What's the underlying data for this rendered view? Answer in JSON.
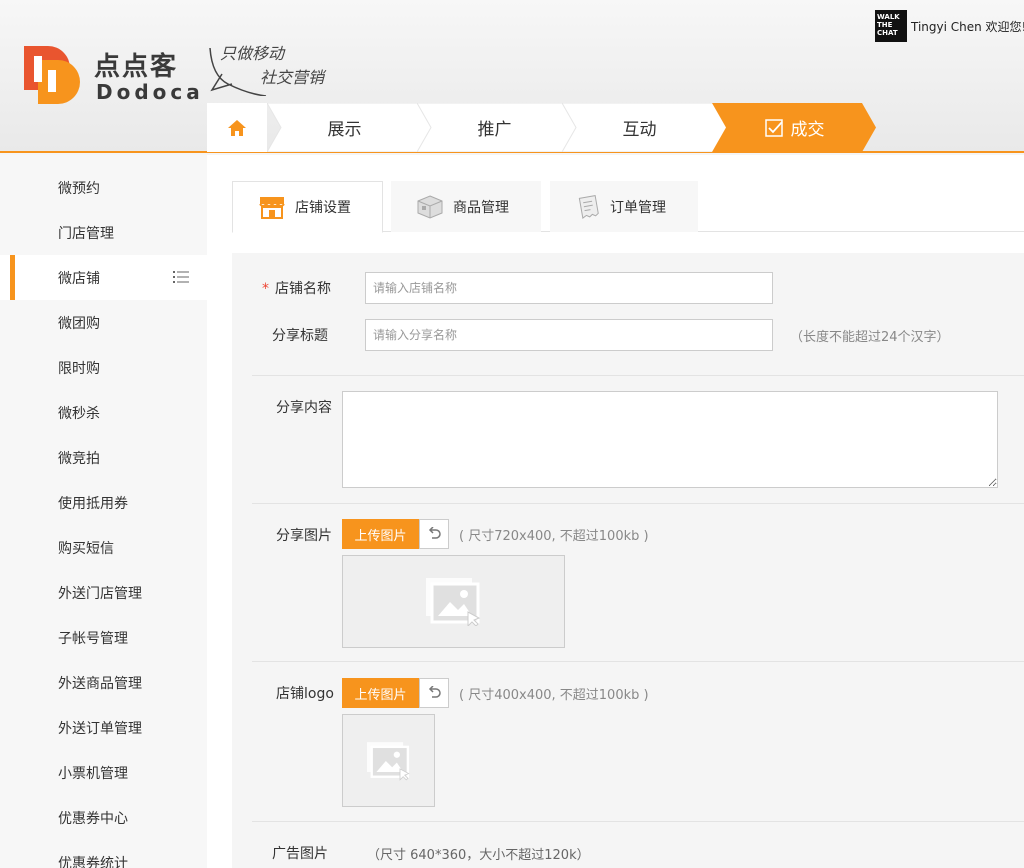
{
  "brand": {
    "name_cn": "点点客",
    "name_en": "Dodoca",
    "slogan_line1": "只做移动",
    "slogan_line2": "社交营销"
  },
  "user": {
    "badge_lines": [
      "WALK",
      "THE",
      "CHAT"
    ],
    "greeting": "Tingyi Chen 欢迎您!"
  },
  "steps": [
    {
      "label": "展示",
      "active": false
    },
    {
      "label": "推广",
      "active": false
    },
    {
      "label": "互动",
      "active": false
    },
    {
      "label": "成交",
      "active": true
    }
  ],
  "sidebar": {
    "items": [
      {
        "label": "微预约"
      },
      {
        "label": "门店管理"
      },
      {
        "label": "微店铺"
      },
      {
        "label": "微团购"
      },
      {
        "label": "限时购"
      },
      {
        "label": "微秒杀"
      },
      {
        "label": "微竞拍"
      },
      {
        "label": "使用抵用券"
      },
      {
        "label": "购买短信"
      },
      {
        "label": "外送门店管理"
      },
      {
        "label": "子帐号管理"
      },
      {
        "label": "外送商品管理"
      },
      {
        "label": "外送订单管理"
      },
      {
        "label": "小票机管理"
      },
      {
        "label": "优惠券中心"
      },
      {
        "label": "优惠券统计"
      }
    ],
    "active_index": 2
  },
  "tabs": [
    {
      "label": "店铺设置",
      "icon": "store-icon"
    },
    {
      "label": "商品管理",
      "icon": "box-icon"
    },
    {
      "label": "订单管理",
      "icon": "receipt-icon"
    }
  ],
  "form": {
    "shop_name": {
      "label": "店铺名称",
      "required_mark": "*",
      "placeholder": "请输入店铺名称",
      "value": ""
    },
    "share_title": {
      "label": "分享标题",
      "placeholder": "请输入分享名称",
      "value": "",
      "hint": "（长度不能超过24个汉字）"
    },
    "share_content": {
      "label": "分享内容",
      "value": ""
    },
    "share_image": {
      "label": "分享图片",
      "upload_label": "上传图片",
      "hint": "( 尺寸720x400, 不超过100kb )"
    },
    "shop_logo": {
      "label": "店铺logo",
      "upload_label": "上传图片",
      "hint": "( 尺寸400x400, 不超过100kb )"
    },
    "ad_image": {
      "label": "广告图片",
      "hint": "（尺寸 640*360，大小不超过120k）"
    }
  },
  "colors": {
    "accent": "#f7941d",
    "required": "#e43"
  }
}
